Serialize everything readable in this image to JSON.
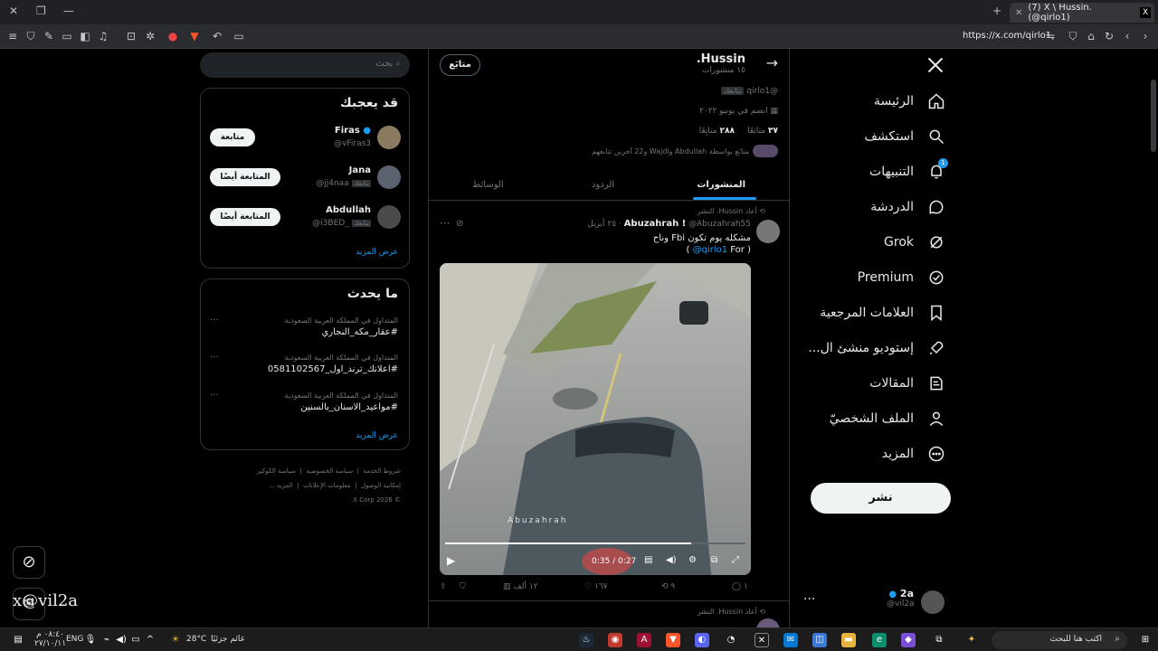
{
  "browser": {
    "tab_title": "(7) X \\ Hussin. (@qirlo1)",
    "url": "https://x.com/qirlo1"
  },
  "nav": {
    "items": [
      {
        "label": "الرئيسة",
        "icon": "home-icon"
      },
      {
        "label": "استكشف",
        "icon": "search-icon"
      },
      {
        "label": "التنبيهات",
        "icon": "bell-icon",
        "badge": "1"
      },
      {
        "label": "الدردشة",
        "icon": "chat-icon"
      },
      {
        "label": "Grok",
        "icon": "grok-icon"
      },
      {
        "label": "Premium",
        "icon": "premium-icon"
      },
      {
        "label": "العلامات المرجعية",
        "icon": "bookmark-icon"
      },
      {
        "label": "إستوديو منشئ ال...",
        "icon": "rocket-icon"
      },
      {
        "label": "المقالات",
        "icon": "article-icon"
      },
      {
        "label": "الملف الشخصيّ",
        "icon": "profile-icon"
      },
      {
        "label": "المزيد",
        "icon": "more-icon"
      }
    ],
    "post_button": "نشر",
    "account": {
      "name": "2a",
      "handle": "@vil2a"
    }
  },
  "profile": {
    "name": "Hussin.",
    "posts_count": "١٥ منشورات",
    "handle": "@qirlo1",
    "follows_you": "يتابعك",
    "following_button": "متابَع",
    "joined": "انضم في يونيو ٢٠٢٢",
    "following_count": "٣٧",
    "following_label": "متابَعًا",
    "followers_count": "٢٨٨",
    "followers_label": "متابِعًا",
    "followed_by": "متابَع بواسطة Abdullah وWajdi و22 آخرين تتابعهم",
    "tabs": [
      "المنشورات",
      "الردود",
      "الوسائط"
    ]
  },
  "post": {
    "repost_label": "أعاد Hussin. النشر",
    "author": "Abuzahrah !",
    "handle": "@Abuzahrah55",
    "date": "٢٥ أبريل",
    "text_line1": "مشكله يوم تكون Fbi وناح",
    "text_line2_prefix": "For",
    "mention": "@qirlo1",
    "video": {
      "watermark": "Abuzahrah",
      "time": "0:35 / 0:27",
      "progress": 0.82
    },
    "actions": {
      "replies": "١",
      "reposts": "٩",
      "likes": "١٦٧",
      "views": "١٢ ألف"
    }
  },
  "post2": {
    "repost_label": "أعاد Hussin. النشر"
  },
  "right": {
    "search_placeholder": "بحث",
    "who_to_follow": {
      "title": "قد يعجبك",
      "users": [
        {
          "name": "Firas",
          "handle": "@vFiras3",
          "button": "متابعة",
          "verified": true
        },
        {
          "name": "Jana",
          "handle": "@jj4naa",
          "button": "المتابعة أيضًا",
          "follows_you": "يتابعك"
        },
        {
          "name": "Abdullah",
          "handle": "@i3BED_",
          "button": "المتابعة أيضًا",
          "follows_you": "يتابعك"
        }
      ],
      "show_more": "عرض المزيد"
    },
    "trends": {
      "title": "ما يحدث",
      "items": [
        {
          "context": "المتداول في المملكة العربية السعودية",
          "tag": "#عقار_مكه_النجاري"
        },
        {
          "context": "المتداول في المملكة العربية السعودية",
          "tag": "#اعلانك_ترند_اول_0581102567"
        },
        {
          "context": "المتداول في المملكة العربية السعودية",
          "tag": "#مواعيد_الاسنان_بالسنين"
        }
      ],
      "show_more": "عرض المزيد"
    },
    "footer": {
      "links": [
        "شروط الخدمة",
        "سياسة الخصوصية",
        "سياسة الكوكيز",
        "إمكانية الوصول",
        "معلومات الإعلانات",
        "المزيد ..."
      ],
      "copyright": "© 2026 X Corp."
    }
  },
  "floating": {
    "watermark": "x@vil2a"
  },
  "taskbar": {
    "search": "اكتب هنا للبحث",
    "weather_text": "غائم جزئيًا",
    "temperature": "28°C",
    "lang": "ENG",
    "time": "٠٨:٤٠ م",
    "date": "٢٧/١٠/١١"
  }
}
